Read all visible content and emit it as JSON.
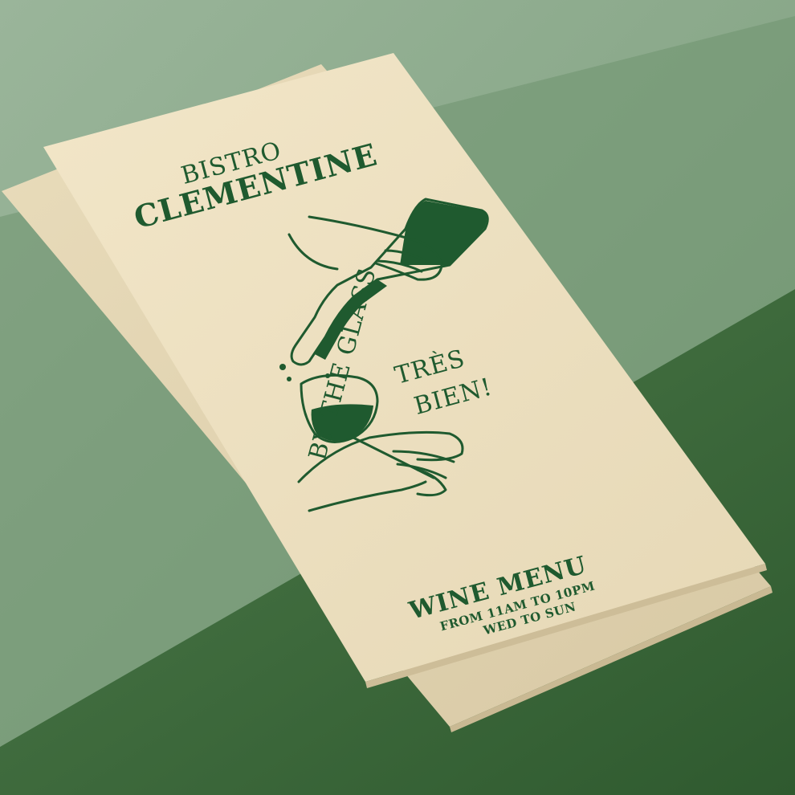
{
  "colors": {
    "wall": "#86a686",
    "table_top": "#3f6a3d",
    "paper": "#efe3c4",
    "ink": "#1f5a2f"
  },
  "flyer": {
    "brand_line1": "BISTRO",
    "brand_line2": "CLEMENTINE",
    "side_text": "BY THE GLASS",
    "tres_line": "TRÈS",
    "bien_line": "BIEN!",
    "menu_title": "WINE MENU",
    "hours_line1": "FROM 11AM TO 10PM",
    "hours_line2": "WED TO SUN"
  }
}
